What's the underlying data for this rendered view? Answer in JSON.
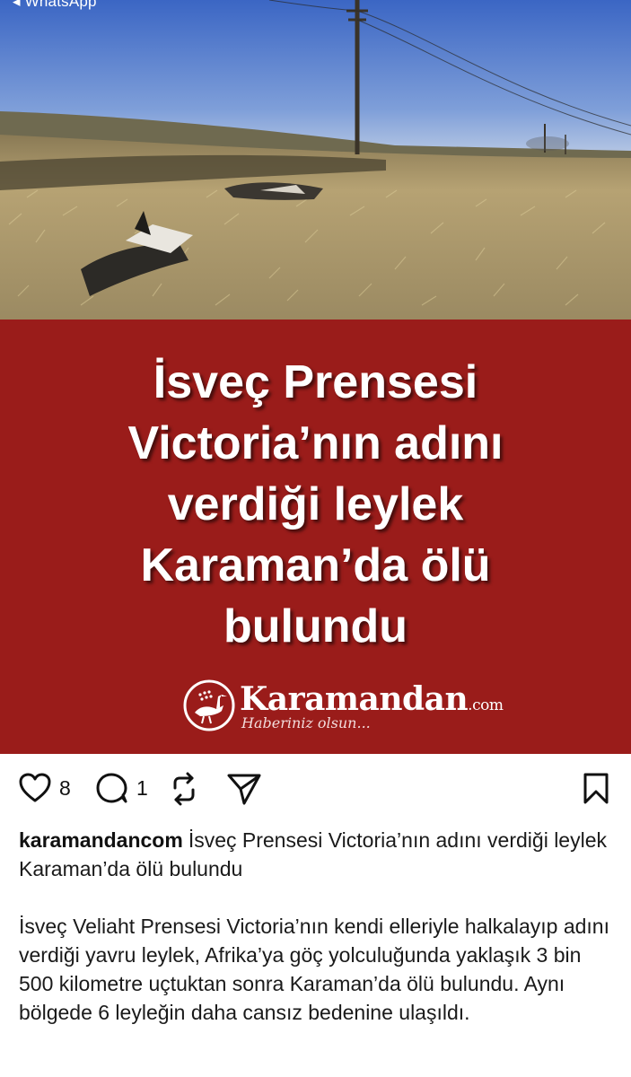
{
  "status_bar": {
    "back_label": "◂ WhatsApp"
  },
  "post": {
    "headline_lines": [
      "İsveç Prensesi",
      "Victoria’nın adını",
      "verdiği leylek",
      "Karaman’da ölü",
      "bulundu"
    ],
    "brand": {
      "name": "Karamandan",
      "tld": ".com",
      "slogan": "Haberiniz olsun..."
    },
    "likes": "8",
    "comments": "1",
    "username": "karamandancom",
    "caption": "İsveç Prensesi Victoria’nın adını verdiği leylek Karaman’da ölü bulundu",
    "body": "İsveç Veliaht Prensesi Victoria’nın kendi elleriyle halkalayıp adını verdiği yavru leylek, Afrika’ya göç yolculuğunda yaklaşık 3 bin 500 kilometre uçtuktan sonra Karaman’da ölü bulundu. Aynı bölgede 6 leyleğin daha cansız bedenine ulaşıldı."
  },
  "icons": {
    "like": "heart-icon",
    "comment": "comment-icon",
    "repost": "repost-icon",
    "share": "send-icon",
    "save": "bookmark-icon"
  },
  "colors": {
    "panel_red": "#9a1c1a",
    "text": "#111111"
  }
}
